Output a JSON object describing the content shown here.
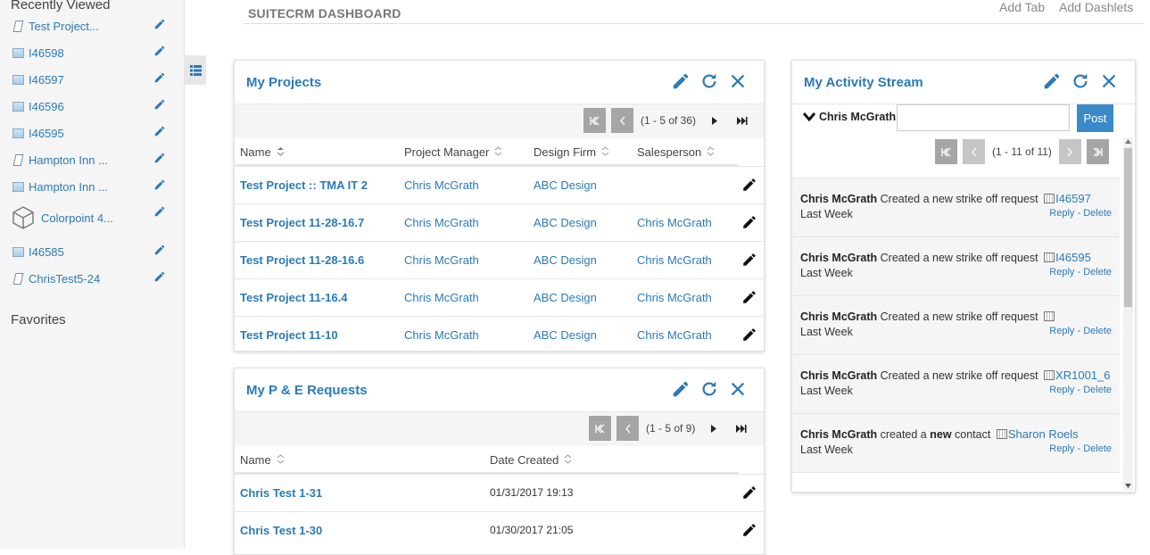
{
  "sidebar": {
    "recently_viewed_heading": "Recently Viewed",
    "favorites_heading": "Favorites",
    "items": [
      {
        "label": "Test Project...",
        "icon": "project-icon"
      },
      {
        "label": "I46598",
        "icon": "module-box-icon"
      },
      {
        "label": "I46597",
        "icon": "module-box-icon"
      },
      {
        "label": "I46596",
        "icon": "module-box-icon"
      },
      {
        "label": "I46595",
        "icon": "module-box-icon"
      },
      {
        "label": "Hampton Inn ...",
        "icon": "project-icon"
      },
      {
        "label": "Hampton Inn ...",
        "icon": "module-box-icon"
      },
      {
        "label": "Colorpoint 4...",
        "icon": "cube-icon"
      },
      {
        "label": "I46585",
        "icon": "module-box-icon"
      },
      {
        "label": "ChrisTest5-24",
        "icon": "project-icon"
      }
    ]
  },
  "header": {
    "title": "SUITECRM DASHBOARD",
    "add_tab": "Add Tab",
    "add_dashlets": "Add Dashlets"
  },
  "my_projects": {
    "title": "My Projects",
    "pagination": "(1 - 5 of 36)",
    "columns": [
      "Name",
      "Project Manager",
      "Design Firm",
      "Salesperson"
    ],
    "rows": [
      {
        "name": "Test Project :: TMA IT 2",
        "manager": "Chris McGrath",
        "firm": "ABC Design",
        "sales": ""
      },
      {
        "name": "Test Project 11-28-16.7",
        "manager": "Chris McGrath",
        "firm": "ABC Design",
        "sales": "Chris McGrath"
      },
      {
        "name": "Test Project 11-28-16.6",
        "manager": "Chris McGrath",
        "firm": "ABC Design",
        "sales": "Chris McGrath"
      },
      {
        "name": "Test Project 11-16.4",
        "manager": "Chris McGrath",
        "firm": "ABC Design",
        "sales": "Chris McGrath"
      },
      {
        "name": "Test Project 11-10",
        "manager": "Chris McGrath",
        "firm": "ABC Design",
        "sales": "Chris McGrath"
      }
    ]
  },
  "pe_requests": {
    "title": "My P & E Requests",
    "pagination": "(1 - 5 of 9)",
    "columns": [
      "Name",
      "Date Created"
    ],
    "rows": [
      {
        "name": "Chris Test 1-31",
        "date": "01/31/2017 19:13"
      },
      {
        "name": "Chris Test 1-30",
        "date": "01/30/2017 21:05"
      }
    ]
  },
  "activity": {
    "title": "My Activity Stream",
    "user_filter": "Chris McGrath",
    "post_button": "Post",
    "post_placeholder": "",
    "pagination": "(1 - 11 of 11)",
    "reply": "Reply",
    "delete": "Delete",
    "items": [
      {
        "actor": "Chris McGrath",
        "pre": "Created a new strike off request",
        "emph": "",
        "post": "",
        "link": "I46597",
        "when": "Last Week"
      },
      {
        "actor": "Chris McGrath",
        "pre": "Created a new strike off request",
        "emph": "",
        "post": "",
        "link": "I46595",
        "when": "Last Week"
      },
      {
        "actor": "Chris McGrath",
        "pre": "Created a new strike off request",
        "emph": "",
        "post": "",
        "link": "",
        "when": "Last Week"
      },
      {
        "actor": "Chris McGrath",
        "pre": "Created a new strike off request",
        "emph": "",
        "post": "",
        "link": "XR1001_6",
        "when": "Last Week"
      },
      {
        "actor": "Chris McGrath",
        "pre": "created a",
        "emph": "new",
        "post": "contact",
        "link": "Sharon Roels",
        "when": "Last Week"
      }
    ]
  },
  "colors": {
    "link": "#2a7ab8",
    "pager_button": "#a5a5a5",
    "post_button": "#3a8ac8",
    "sidebar_bg": "#f5f5f5"
  }
}
